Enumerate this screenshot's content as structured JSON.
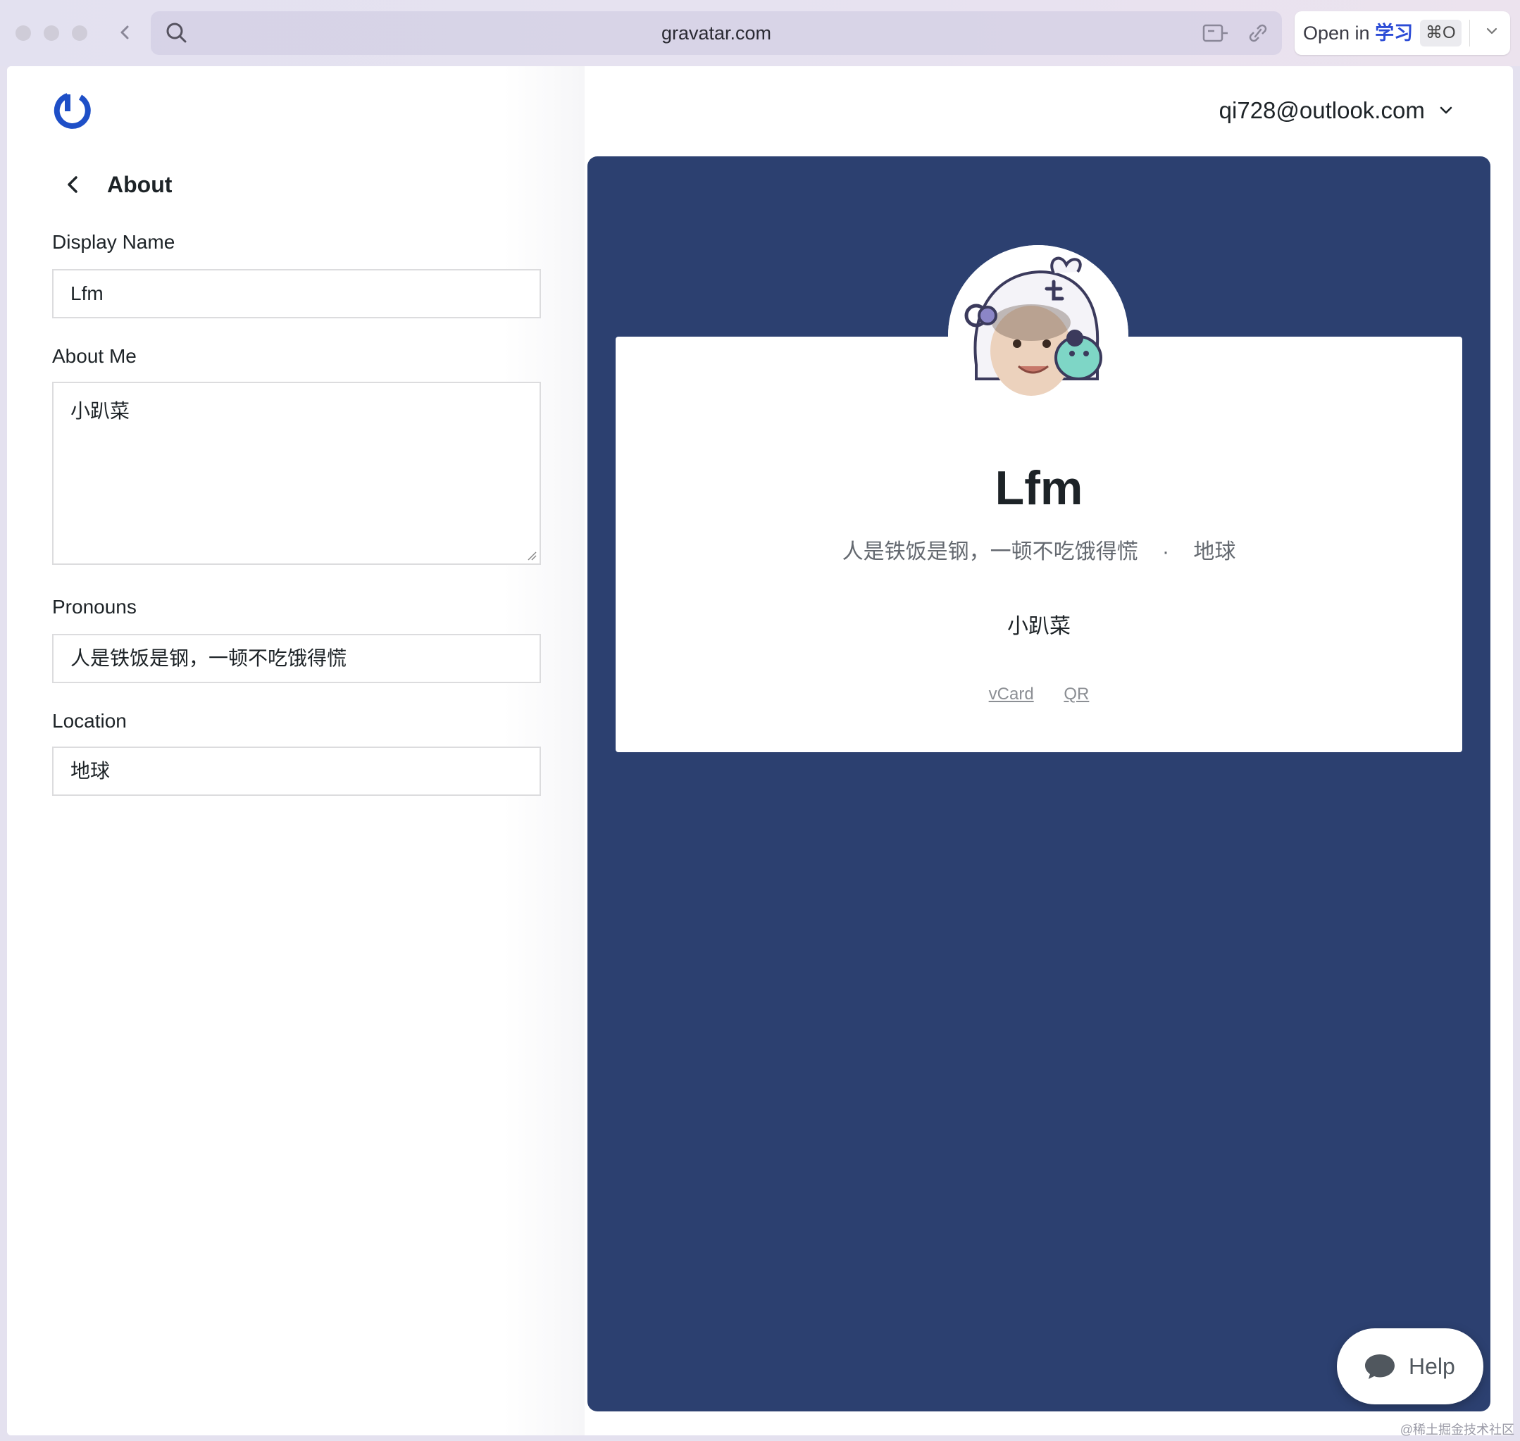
{
  "browser": {
    "url": "gravatar.com",
    "open_in_prefix": "Open in",
    "open_in_app": "学习",
    "open_in_shortcut": "⌘O"
  },
  "header": {
    "account_email": "qi728@outlook.com",
    "brand_color": "#1e4fc7"
  },
  "editor": {
    "section_title": "About",
    "fields": {
      "display_name": {
        "label": "Display Name",
        "value": "Lfm"
      },
      "about_me": {
        "label": "About Me",
        "value": "小趴菜"
      },
      "pronouns": {
        "label": "Pronouns",
        "value": "人是铁饭是钢，一顿不吃饿得慌"
      },
      "location": {
        "label": "Location",
        "value": "地球"
      }
    }
  },
  "preview": {
    "background_color": "#2c4070",
    "name": "Lfm",
    "pronouns": "人是铁饭是钢，一顿不吃饿得慌",
    "separator": "·",
    "location": "地球",
    "about": "小趴菜",
    "links": [
      "vCard",
      "QR"
    ]
  },
  "help": {
    "label": "Help"
  },
  "watermark": "@稀土掘金技术社区"
}
